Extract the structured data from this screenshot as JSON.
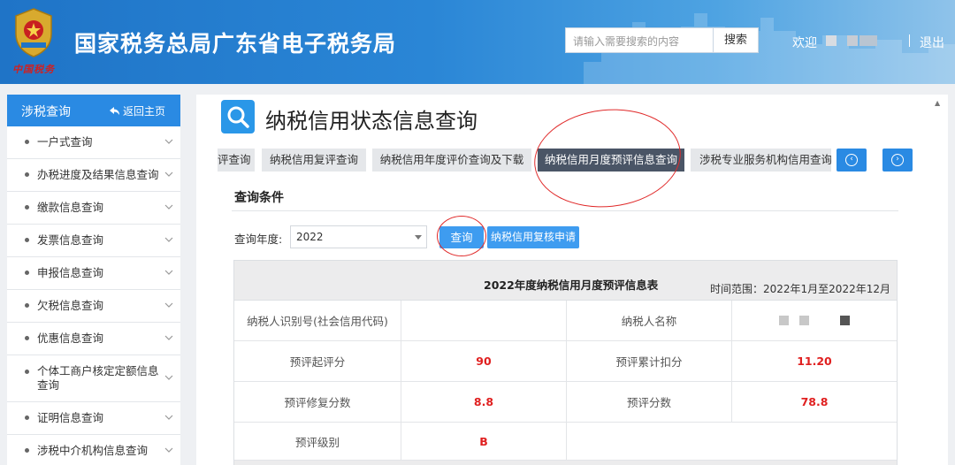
{
  "header": {
    "brand_text": "中国税务",
    "site_title": "国家税务总局广东省电子税务局",
    "search_placeholder": "请输入需要搜索的内容",
    "search_button": "搜索",
    "welcome": "欢迎",
    "logout": "退出",
    "separator": "|"
  },
  "sidebar": {
    "title": "涉税查询",
    "back": "返回主页",
    "items": [
      {
        "label": "一户式查询"
      },
      {
        "label": "办税进度及结果信息查询"
      },
      {
        "label": "缴款信息查询"
      },
      {
        "label": "发票信息查询"
      },
      {
        "label": "申报信息查询"
      },
      {
        "label": "欠税信息查询"
      },
      {
        "label": "优惠信息查询"
      },
      {
        "label": "个体工商户核定定额信息查询"
      },
      {
        "label": "证明信息查询"
      },
      {
        "label": "涉税中介机构信息查询"
      }
    ]
  },
  "main": {
    "page_title": "纳税信用状态信息查询",
    "tabs": [
      {
        "label": "评查询"
      },
      {
        "label": "纳税信用复评查询"
      },
      {
        "label": "纳税信用年度评价查询及下载"
      },
      {
        "label": "纳税信用月度预评信息查询"
      },
      {
        "label": "涉税专业服务机构信用查询"
      }
    ],
    "active_tab": 3,
    "nav_prev": "‹",
    "nav_next": "›",
    "section_title": "查询条件",
    "year_label": "查询年度:",
    "year_value": "2022",
    "query_button": "查询",
    "review_button": "纳税信用复核申请",
    "table": {
      "caption": "2022年度纳税信用月度预评信息表",
      "time_range": "时间范围：2022年1月至2022年12月",
      "rows": [
        {
          "l1": "纳税人识别号(社会信用代码)",
          "v1": "",
          "l2": "纳税人名称",
          "v2": ""
        },
        {
          "l1": "预评起评分",
          "v1": "90",
          "l2": "预评累计扣分",
          "v2": "11.20"
        },
        {
          "l1": "预评修复分数",
          "v1": "8.8",
          "l2": "预评分数",
          "v2": "78.8"
        },
        {
          "l1": "预评级别",
          "v1": "B",
          "l2": "",
          "v2": ""
        }
      ]
    }
  },
  "colors": {
    "header_blue": "#1f74c7",
    "sidebar_blue": "#2a8ae3",
    "active_tab": "#4a5566",
    "button_blue": "#3e9cf0",
    "value_red": "#e02020",
    "annotation_red": "#e02a2a"
  }
}
